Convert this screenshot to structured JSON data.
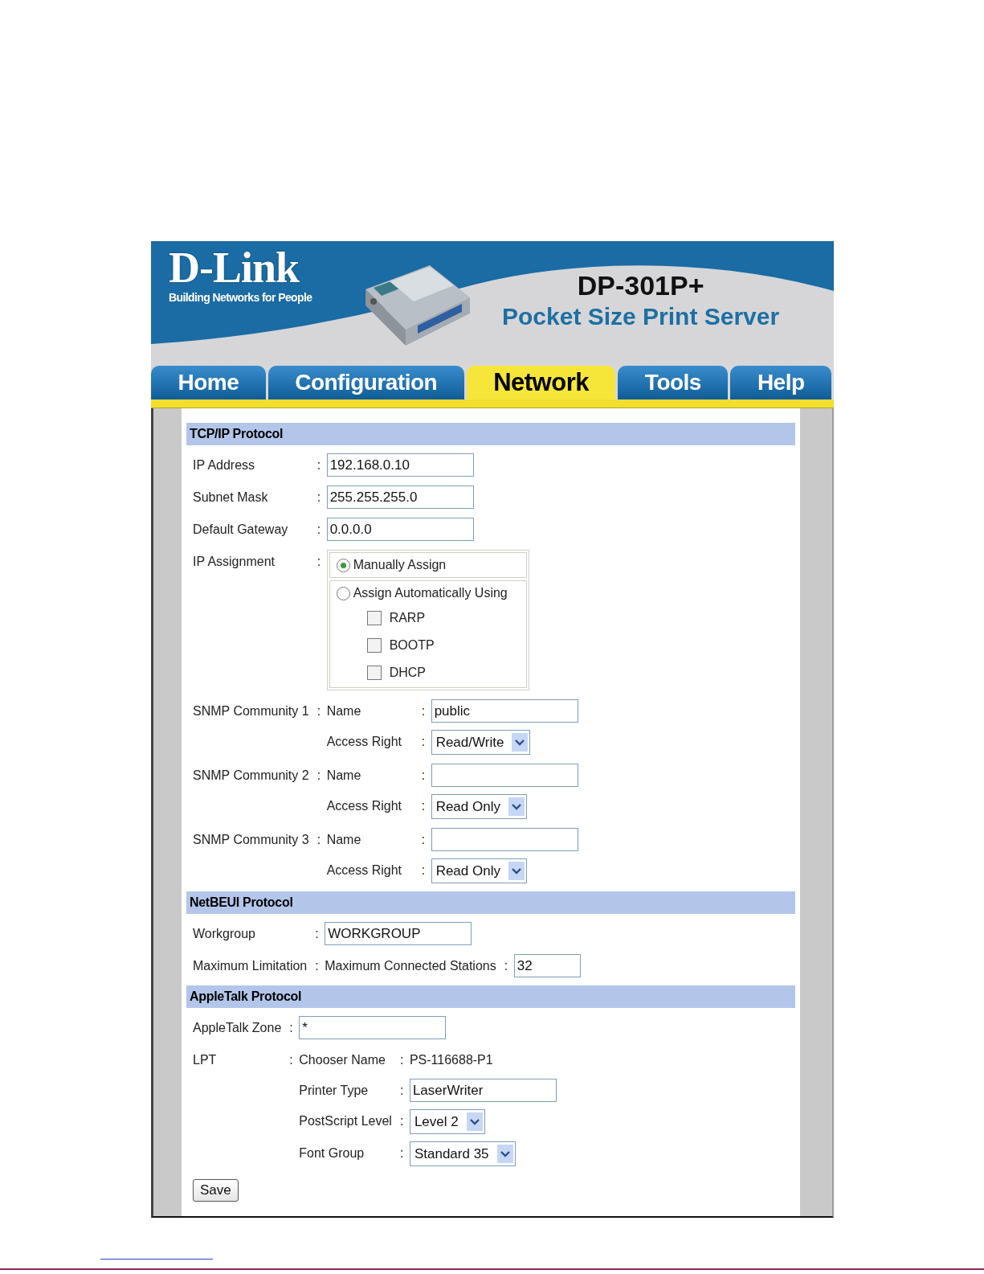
{
  "header": {
    "logo": "D-Link",
    "tagline": "Building Networks for People",
    "model": "DP-301P+",
    "product": "Pocket Size Print Server"
  },
  "tabs": [
    {
      "label": "Home",
      "selected": false
    },
    {
      "label": "Configuration",
      "selected": false
    },
    {
      "label": "Network",
      "selected": true
    },
    {
      "label": "Tools",
      "selected": false
    },
    {
      "label": "Help",
      "selected": false
    }
  ],
  "sections": [
    {
      "title": "TCP/IP Protocol",
      "rows": [
        {
          "kind": "field",
          "label": "IP Address",
          "colon": ":",
          "value": "192.168.0.10"
        },
        {
          "kind": "field",
          "label": "Subnet Mask",
          "colon": ":",
          "value": "255.255.255.0"
        },
        {
          "kind": "field",
          "label": "Default Gateway",
          "colon": ":",
          "value": "0.0.0.0"
        },
        {
          "kind": "assign",
          "label": "IP Assignment",
          "colon": ":",
          "options": [
            {
              "label": "Manually Assign",
              "selected": true
            },
            {
              "label": "Assign Automatically Using",
              "selected": false,
              "checkboxes": [
                {
                  "label": "RARP",
                  "checked": false
                },
                {
                  "label": "BOOTP",
                  "checked": false
                },
                {
                  "label": "DHCP",
                  "checked": false
                }
              ]
            }
          ]
        },
        {
          "kind": "sub",
          "label": "SNMP Community 1",
          "colon": ":",
          "items": [
            {
              "kind": "field",
              "label": "Name",
              "colon": ":",
              "value": "public"
            },
            {
              "kind": "select",
              "label": "Access Right",
              "colon": ":",
              "value": "Read/Write"
            }
          ]
        },
        {
          "kind": "sub",
          "label": "SNMP Community 2",
          "colon": ":",
          "items": [
            {
              "kind": "field",
              "label": "Name",
              "colon": ":",
              "value": ""
            },
            {
              "kind": "select",
              "label": "Access Right",
              "colon": ":",
              "value": "Read Only"
            }
          ]
        },
        {
          "kind": "sub",
          "label": "SNMP Community 3",
          "colon": ":",
          "items": [
            {
              "kind": "field",
              "label": "Name",
              "colon": ":",
              "value": ""
            },
            {
              "kind": "select",
              "label": "Access Right",
              "colon": ":",
              "value": "Read Only"
            }
          ]
        }
      ]
    },
    {
      "title": "NetBEUI Protocol",
      "rows": [
        {
          "kind": "field",
          "label": "Workgroup",
          "colon": ":",
          "value": "WORKGROUP"
        },
        {
          "kind": "sub",
          "label": "Maximum Limitation",
          "colon": ":",
          "items": [
            {
              "kind": "small",
              "label": "Maximum Connected Stations",
              "colon": ":",
              "value": "32"
            }
          ]
        }
      ]
    },
    {
      "title": "AppleTalk Protocol",
      "rows": [
        {
          "kind": "field",
          "label": "AppleTalk Zone",
          "colon": ":",
          "value": "*"
        },
        {
          "kind": "sub",
          "label": "LPT",
          "colon": ":",
          "items": [
            {
              "kind": "text",
              "label": "Chooser Name",
              "colon": ":",
              "value": "PS-116688-P1"
            },
            {
              "kind": "field",
              "label": "Printer Type",
              "colon": ":",
              "value": "LaserWriter"
            },
            {
              "kind": "select",
              "label": "PostScript Level",
              "colon": ":",
              "value": "Level 2"
            },
            {
              "kind": "select",
              "label": "Font Group",
              "colon": ":",
              "value": "Standard 35"
            }
          ]
        }
      ]
    }
  ],
  "save": "Save"
}
